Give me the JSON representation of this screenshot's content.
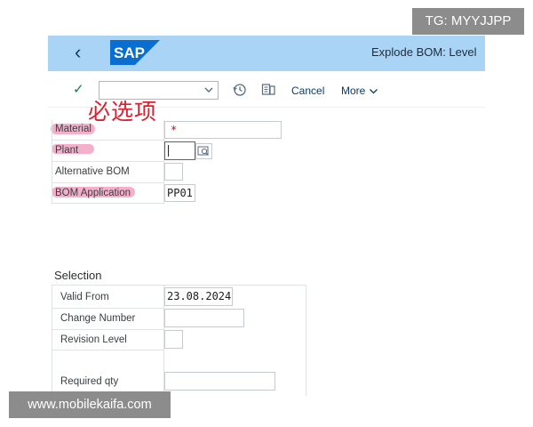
{
  "header": {
    "back_glyph": "‹",
    "logo_text": "SAP",
    "brand_color": "#0a6ed1",
    "title": "Explode BOM: Level"
  },
  "toolbar": {
    "check_glyph": "✓",
    "variant_value": "",
    "cancel_label": "Cancel",
    "more_label": "More",
    "icons": [
      "checkmark-icon",
      "history-icon",
      "details-icon",
      "chevron-down-icon"
    ]
  },
  "annotation": {
    "text": "必选项",
    "color": "#e11d2e"
  },
  "fields": {
    "material": {
      "label": "Material",
      "value": "*"
    },
    "plant": {
      "label": "Plant",
      "value": ""
    },
    "alt_bom": {
      "label": "Alternative BOM",
      "value": ""
    },
    "bom_app": {
      "label": "BOM Application",
      "value": "PP01"
    }
  },
  "selection": {
    "heading": "Selection",
    "valid_from": {
      "label": "Valid From",
      "value": "23.08.2024"
    },
    "change_number": {
      "label": "Change Number",
      "value": ""
    },
    "revision_level": {
      "label": "Revision Level",
      "value": ""
    },
    "required_qty": {
      "label": "Required qty",
      "value": ""
    }
  },
  "watermarks": {
    "tg": "TG: MYYJJPP",
    "site": "www.mobilekaifa.com"
  }
}
